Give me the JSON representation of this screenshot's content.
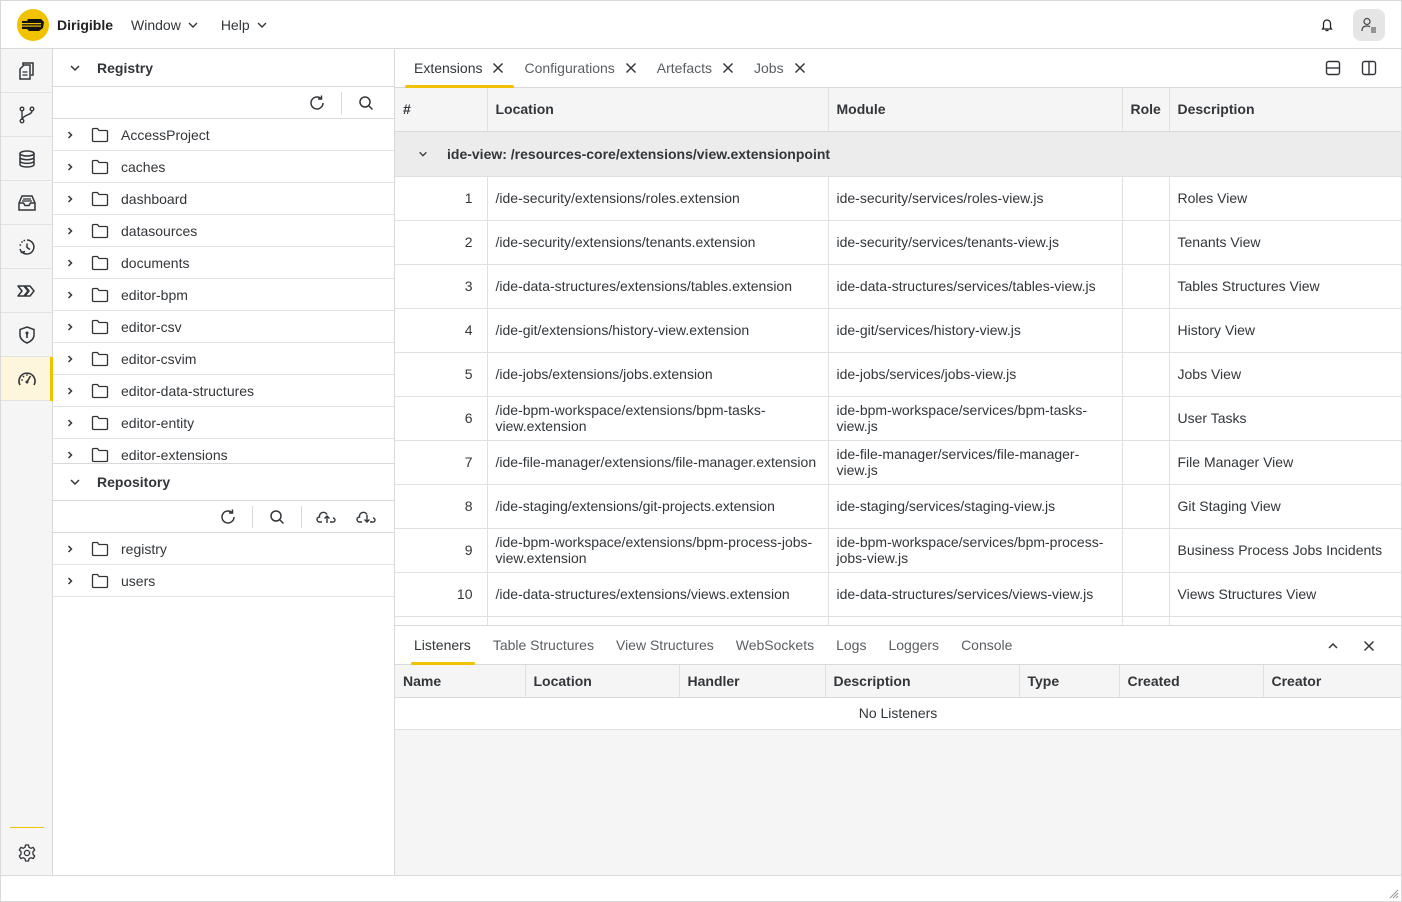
{
  "app": {
    "title": "Dirigible",
    "menus": [
      {
        "label": "Window"
      },
      {
        "label": "Help"
      }
    ],
    "brand_color": "#f0c200"
  },
  "activity_bar": {
    "items": [
      {
        "name": "projects",
        "icon": "documents-icon"
      },
      {
        "name": "git",
        "icon": "git-branch-icon"
      },
      {
        "name": "database",
        "icon": "database-icon"
      },
      {
        "name": "repository",
        "icon": "inbox-icon"
      },
      {
        "name": "history",
        "icon": "history-icon"
      },
      {
        "name": "flows",
        "icon": "chevrons-icon"
      },
      {
        "name": "security",
        "icon": "shield-icon"
      },
      {
        "name": "operations",
        "icon": "gauge-icon",
        "active": true
      }
    ],
    "settings_icon": "gear-icon"
  },
  "registry": {
    "title": "Registry",
    "items": [
      "AccessProject",
      "caches",
      "dashboard",
      "datasources",
      "documents",
      "editor-bpm",
      "editor-csv",
      "editor-csvim",
      "editor-data-structures",
      "editor-entity",
      "editor-extensions"
    ]
  },
  "repository": {
    "title": "Repository",
    "items": [
      "registry",
      "users"
    ]
  },
  "main_tabs": [
    {
      "label": "Extensions",
      "active": true
    },
    {
      "label": "Configurations"
    },
    {
      "label": "Artefacts"
    },
    {
      "label": "Jobs"
    }
  ],
  "extensions": {
    "columns": [
      "#",
      "Location",
      "Module",
      "Role",
      "Description"
    ],
    "group": "ide-view: /resources-core/extensions/view.extensionpoint",
    "rows": [
      {
        "n": "1",
        "location": "/ide-security/extensions/roles.extension",
        "module": "ide-security/services/roles-view.js",
        "role": "",
        "description": "Roles View"
      },
      {
        "n": "2",
        "location": "/ide-security/extensions/tenants.extension",
        "module": "ide-security/services/tenants-view.js",
        "role": "",
        "description": "Tenants View"
      },
      {
        "n": "3",
        "location": "/ide-data-structures/extensions/tables.extension",
        "module": "ide-data-structures/services/tables-view.js",
        "role": "",
        "description": "Tables Structures View"
      },
      {
        "n": "4",
        "location": "/ide-git/extensions/history-view.extension",
        "module": "ide-git/services/history-view.js",
        "role": "",
        "description": "History View"
      },
      {
        "n": "5",
        "location": "/ide-jobs/extensions/jobs.extension",
        "module": "ide-jobs/services/jobs-view.js",
        "role": "",
        "description": "Jobs View"
      },
      {
        "n": "6",
        "location": "/ide-bpm-workspace/extensions/bpm-tasks-view.extension",
        "module": "ide-bpm-workspace/services/bpm-tasks-view.js",
        "role": "",
        "description": "User Tasks"
      },
      {
        "n": "7",
        "location": "/ide-file-manager/extensions/file-manager.extension",
        "module": "ide-file-manager/services/file-manager-view.js",
        "role": "",
        "description": "File Manager View"
      },
      {
        "n": "8",
        "location": "/ide-staging/extensions/git-projects.extension",
        "module": "ide-staging/services/staging-view.js",
        "role": "",
        "description": "Git Staging View"
      },
      {
        "n": "9",
        "location": "/ide-bpm-workspace/extensions/bpm-process-jobs-view.extension",
        "module": "ide-bpm-workspace/services/bpm-process-jobs-view.js",
        "role": "",
        "description": "Business Process Jobs Incidents"
      },
      {
        "n": "10",
        "location": "/ide-data-structures/extensions/views.extension",
        "module": "ide-data-structures/services/views-view.js",
        "role": "",
        "description": "Views Structures View"
      }
    ]
  },
  "bottom_tabs": [
    {
      "label": "Listeners",
      "active": true
    },
    {
      "label": "Table Structures"
    },
    {
      "label": "View Structures"
    },
    {
      "label": "WebSockets"
    },
    {
      "label": "Logs"
    },
    {
      "label": "Loggers"
    },
    {
      "label": "Console"
    }
  ],
  "listeners": {
    "columns": [
      "Name",
      "Location",
      "Handler",
      "Description",
      "Type",
      "Created",
      "Creator"
    ],
    "empty_text": "No Listeners"
  }
}
